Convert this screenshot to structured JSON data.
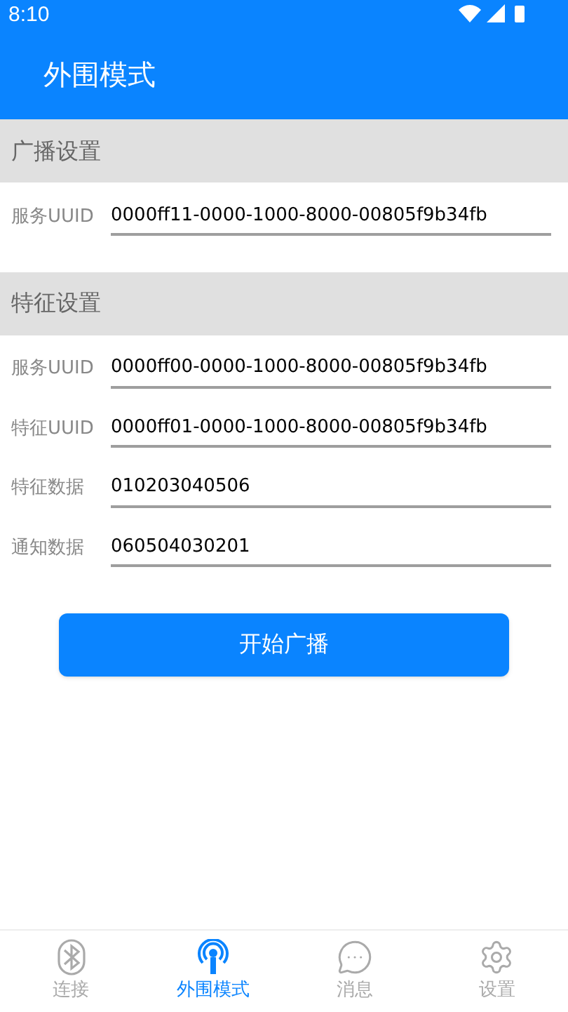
{
  "status_bar": {
    "time": "8:10"
  },
  "header": {
    "title": "外围模式"
  },
  "sections": [
    {
      "title": "广播设置",
      "fields": [
        {
          "label": "服务UUID",
          "value": "0000ff11-0000-1000-8000-00805f9b34fb"
        }
      ]
    },
    {
      "title": "特征设置",
      "fields": [
        {
          "label": "服务UUID",
          "value": "0000ff00-0000-1000-8000-00805f9b34fb"
        },
        {
          "label": "特征UUID",
          "value": "0000ff01-0000-1000-8000-00805f9b34fb"
        },
        {
          "label": "特征数据",
          "value": "010203040506"
        },
        {
          "label": "通知数据",
          "value": "060504030201"
        }
      ]
    }
  ],
  "primary_button": "开始广播",
  "bottom_nav": [
    {
      "kind": "bluetooth",
      "label": "连接",
      "selected": false
    },
    {
      "kind": "broadcast",
      "label": "外围模式",
      "selected": true
    },
    {
      "kind": "message",
      "label": "消息",
      "selected": false
    },
    {
      "kind": "settings",
      "label": "设置",
      "selected": false
    }
  ]
}
